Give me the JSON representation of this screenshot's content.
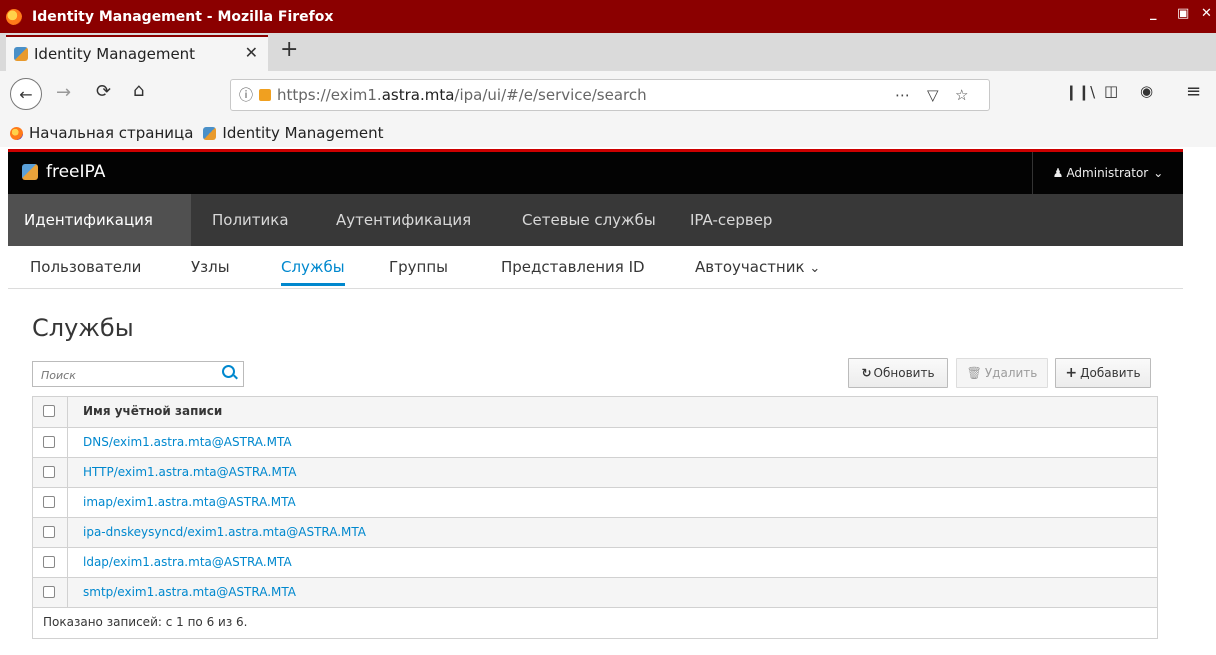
{
  "window": {
    "title": "Identity Management - Mozilla Firefox"
  },
  "tab": {
    "label": "Identity Management"
  },
  "address_bar": {
    "url_pre": "https://exim1.",
    "url_host": "astra.mta",
    "url_post": "/ipa/ui/#/e/service/search"
  },
  "bookmarks": [
    "Начальная страница",
    "Identity Management"
  ],
  "app": {
    "brand": "freeIPA",
    "user": "Administrator"
  },
  "menu_primary": [
    "Идентификация",
    "Политика",
    "Аутентификация",
    "Сетевые службы",
    "IPA-сервер"
  ],
  "menu_secondary": [
    "Пользователи",
    "Узлы",
    "Службы",
    "Группы",
    "Представления ID",
    "Автоучастник"
  ],
  "page": {
    "title": "Службы"
  },
  "search": {
    "placeholder": "Поиск"
  },
  "buttons": {
    "refresh": "Обновить",
    "delete": "Удалить",
    "add": "Добавить"
  },
  "table": {
    "header": "Имя учётной записи",
    "rows": [
      "DNS/exim1.astra.mta@ASTRA.MTA",
      "HTTP/exim1.astra.mta@ASTRA.MTA",
      "imap/exim1.astra.mta@ASTRA.MTA",
      "ipa-dnskeysyncd/exim1.astra.mta@ASTRA.MTA",
      "ldap/exim1.astra.mta@ASTRA.MTA",
      "smtp/exim1.astra.mta@ASTRA.MTA"
    ],
    "footer": "Показано записей: с 1 по 6 из 6."
  }
}
